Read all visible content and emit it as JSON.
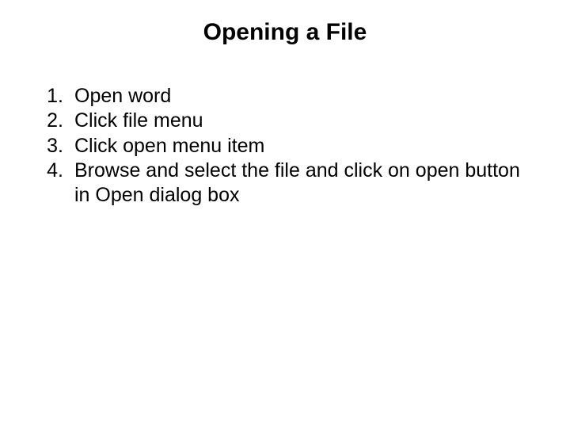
{
  "title": "Opening a File",
  "steps": [
    {
      "num": "1.",
      "text": "Open word"
    },
    {
      "num": "2.",
      "text": "Click file menu"
    },
    {
      "num": "3.",
      "text": "Click open menu item"
    },
    {
      "num": "4.",
      "text": "Browse and select the file and click on open button in Open dialog box"
    }
  ]
}
